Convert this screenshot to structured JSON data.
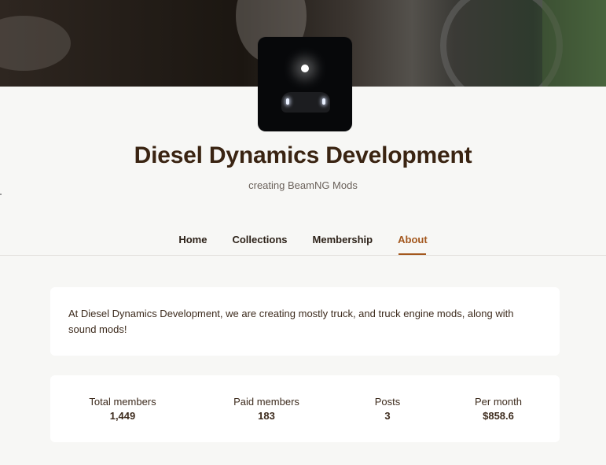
{
  "creator": {
    "name": "Diesel Dynamics Development",
    "tagline": "creating BeamNG Mods"
  },
  "tabs": [
    {
      "label": "Home"
    },
    {
      "label": "Collections"
    },
    {
      "label": "Membership"
    },
    {
      "label": "About",
      "active": true
    }
  ],
  "about": {
    "text": "At Diesel Dynamics Development, we are creating mostly truck, and truck engine mods, along with sound mods!"
  },
  "stats": [
    {
      "label": "Total members",
      "value": "1,449"
    },
    {
      "label": "Paid members",
      "value": "183"
    },
    {
      "label": "Posts",
      "value": "3"
    },
    {
      "label": "Per month",
      "value": "$858.6"
    }
  ],
  "colors": {
    "accent": "#a3571d",
    "title": "#3a2412",
    "background": "#f7f7f5",
    "card": "#ffffff"
  }
}
